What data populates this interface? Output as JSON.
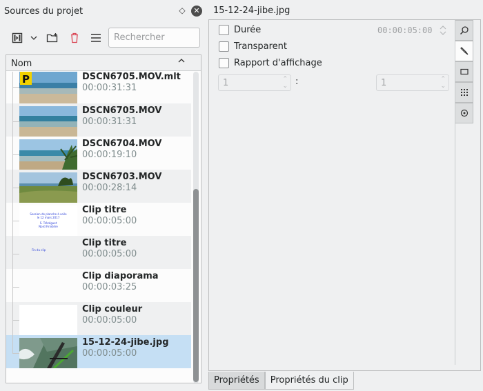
{
  "sources_panel": {
    "title": "Sources du projet",
    "search_placeholder": "Rechercher",
    "column_header": "Nom",
    "clips": [
      {
        "name": "DSCN6705.MOV.mlt",
        "duration": "00:00:31:31",
        "thumb": "beach-playlist"
      },
      {
        "name": "DSCN6705.MOV",
        "duration": "00:00:31:31",
        "thumb": "beach"
      },
      {
        "name": "DSCN6704.MOV",
        "duration": "00:00:19:10",
        "thumb": "beach-palm"
      },
      {
        "name": "DSCN6703.MOV",
        "duration": "00:00:28:14",
        "thumb": "dunes"
      },
      {
        "name": "Clip titre",
        "duration": "00:00:05:00",
        "thumb": "title-text-1",
        "thumb_text": [
          "Session de planche à voile",
          "le 12 mars 2017",
          "",
          "S. Trézéguet",
          "Nord Finistère"
        ]
      },
      {
        "name": "Clip titre",
        "duration": "00:00:05:00",
        "thumb": "title-text-2",
        "thumb_text": [
          "Fin du clip"
        ]
      },
      {
        "name": "Clip diaporama",
        "duration": "00:00:03:25",
        "thumb": "blank"
      },
      {
        "name": "Clip couleur",
        "duration": "00:00:05:00",
        "thumb": "white"
      },
      {
        "name": "15-12-24-jibe.jpg",
        "duration": "00:00:05:00",
        "thumb": "windsurf",
        "selected": true
      }
    ]
  },
  "properties_panel": {
    "file_title": "15-12-24-jibe.jpg",
    "checkboxes": {
      "duration": "Durée",
      "transparent": "Transparent",
      "aspect": "Rapport d'affichage"
    },
    "duration_value": "00:00:05:00",
    "aspect_num": "1",
    "aspect_den": "1",
    "aspect_sep": ":",
    "side_tabs": [
      "magnifier-icon",
      "marker-icon",
      "rectangle-icon",
      "grid-icon",
      "audio-icon"
    ],
    "bottom_tabs": [
      "Propriétés",
      "Propriétés du clip"
    ]
  },
  "colors": {
    "selection": "#c5dff4",
    "background": "#eff0f1",
    "delete": "#da4453"
  }
}
